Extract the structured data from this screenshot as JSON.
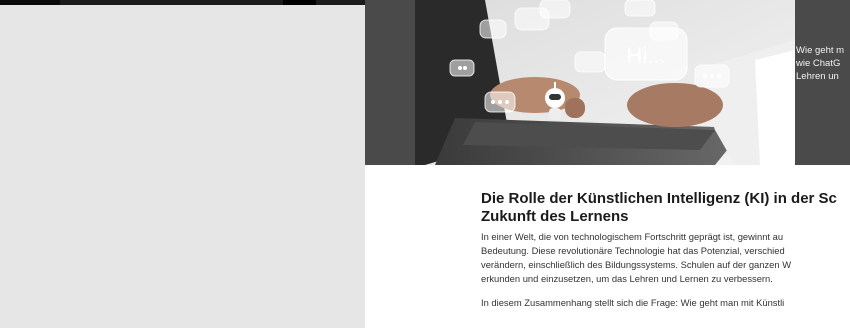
{
  "hero": {
    "caption_lines": [
      "Wie geht m",
      "wie ChatG",
      "Lehren un"
    ],
    "chat_bubble_text": "Hi..."
  },
  "article": {
    "headline_lines": [
      "Die Rolle der Künstlichen Intelligenz (KI) in der Sc",
      "Zukunft des Lernens"
    ],
    "paragraph1_lines": [
      "In einer Welt, die von technologischem Fortschritt geprägt ist, gewinnt au",
      "Bedeutung. Diese revolutionäre Technologie hat das Potenzial, verschied",
      "verändern, einschließlich des Bildungssystems. Schulen auf der ganzen W",
      "erkunden und einzusetzen, um das Lehren und Lernen zu verbessern."
    ],
    "paragraph2_lines": [
      "In diesem Zusammenhang stellt sich die Frage: Wie geht man mit Künstli"
    ]
  },
  "colors": {
    "page_background": "#e6e6e6",
    "hero_background": "#4a4a4a",
    "article_background": "#ffffff"
  }
}
